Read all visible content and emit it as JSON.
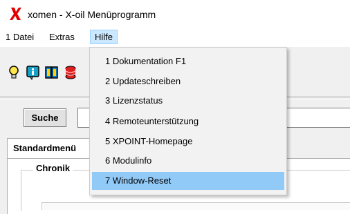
{
  "window": {
    "title": "xomen - X-oil Menüprogramm",
    "logo_icon": "red-x-logo-icon"
  },
  "menubar": {
    "items": [
      {
        "label": "1 Datei"
      },
      {
        "label": "Extras"
      },
      {
        "label": "Hilfe",
        "active": true
      }
    ]
  },
  "toolbar": {
    "icons": [
      "lightbulb-icon",
      "info-icon",
      "book-icon",
      "database-icon"
    ]
  },
  "search": {
    "button_label": "Suche",
    "input_value": ""
  },
  "tabs": {
    "active_label": "Standardmenü"
  },
  "group": {
    "label": "Chronik"
  },
  "help_menu": {
    "items": [
      {
        "label": "1 Dokumentation F1"
      },
      {
        "label": "2 Updateschreiben"
      },
      {
        "label": "3 Lizenzstatus"
      },
      {
        "label": "4 Remoteunterstützung"
      },
      {
        "label": "5 XPOINT-Homepage"
      },
      {
        "label": "6 Modulinfo"
      },
      {
        "label": "7 Window-Reset",
        "highlighted": true
      }
    ]
  },
  "colors": {
    "menu_highlight": "#91c9f7",
    "menubar_active": "#cce8ff",
    "logo_red": "#e00000"
  }
}
